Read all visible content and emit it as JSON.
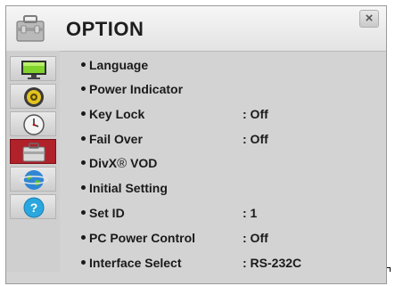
{
  "header": {
    "title": "OPTION",
    "icon": "toolbox-icon",
    "close_icon": "×"
  },
  "sidebar": {
    "items": [
      {
        "name": "picture",
        "icon": "tv-icon",
        "active": false
      },
      {
        "name": "sound",
        "icon": "speaker-icon",
        "active": false
      },
      {
        "name": "time",
        "icon": "clock-icon",
        "active": false
      },
      {
        "name": "option",
        "icon": "toolbox-icon",
        "active": true
      },
      {
        "name": "network",
        "icon": "globe-icon",
        "active": false
      },
      {
        "name": "support",
        "icon": "help-icon",
        "active": false
      }
    ]
  },
  "menu": {
    "items": [
      {
        "label": "Language",
        "value": ""
      },
      {
        "label": "Power Indicator",
        "value": ""
      },
      {
        "label": "Key Lock",
        "value": ": Off"
      },
      {
        "label": "Fail Over",
        "value": ": Off"
      },
      {
        "label": "DivX",
        "label_mark": "®",
        "label_suffix": " VOD",
        "value": ""
      },
      {
        "label": "Initial Setting",
        "value": ""
      },
      {
        "label": "Set ID",
        "value": ": 1"
      },
      {
        "label": "PC Power Control",
        "value": ": Off"
      },
      {
        "label": "Interface Select",
        "value": ": RS-232C"
      }
    ]
  },
  "colors": {
    "active_tab": "#b0212a",
    "panel_bg": "#d3d3d3",
    "header_bg": "#ececec"
  }
}
